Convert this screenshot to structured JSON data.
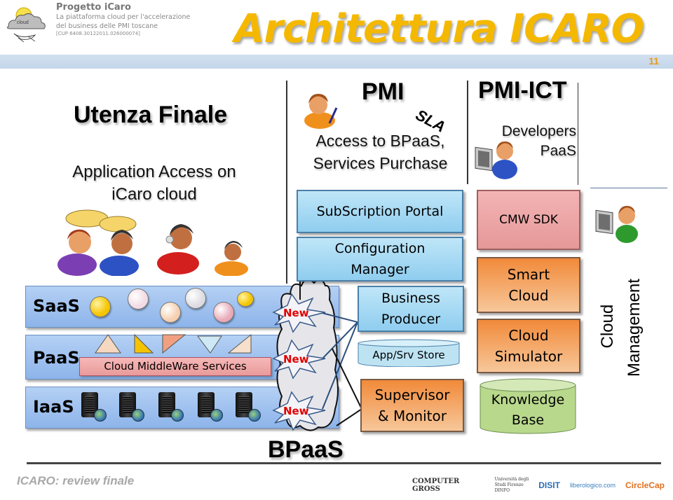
{
  "header": {
    "project_title": "Progetto iCaro",
    "project_subtitle_1": "La piattaforma cloud per l'accelerazione",
    "project_subtitle_2": "del business delle PMI toscane",
    "project_cup": "[CUP 6408.30122011.026000074]",
    "logo_label": "cloud",
    "main_title": "Architettura ICARO",
    "page_number": "11"
  },
  "end_user": {
    "heading": "Utenza Finale",
    "description_1": "Application Access on",
    "description_2": "iCaro cloud"
  },
  "layers": [
    {
      "label": "SaaS",
      "balls": [
        "#f5c400",
        "#f6e4ea",
        "#f7d2b8",
        "#e4e4e8",
        "#eab4c0",
        "#f5c400"
      ]
    },
    {
      "label": "PaaS",
      "middleware": "Cloud MiddleWare Services"
    },
    {
      "label": "IaaS",
      "server_count": 5
    }
  ],
  "bpaas": {
    "label": "BPaaS",
    "new_badges": [
      "New",
      "New",
      "New"
    ]
  },
  "pmi": {
    "heading": "PMI",
    "sla": "SLA",
    "description_1": "Access to BPaaS,",
    "description_2": "Services Purchase",
    "boxes": {
      "subscription_portal": "SubScription Portal",
      "configuration_manager_1": "Configuration",
      "configuration_manager_2": "Manager",
      "business_producer_1": "Business",
      "business_producer_2": "Producer",
      "app_store": "App/Srv Store",
      "supervisor_1": "Supervisor",
      "supervisor_2": "& Monitor"
    }
  },
  "pmi_ict": {
    "heading": "PMI-ICT",
    "description_1": "Developers",
    "description_2": "PaaS",
    "boxes": {
      "cmw_sdk": "CMW SDK",
      "smart_cloud_1": "Smart",
      "smart_cloud_2": "Cloud",
      "cloud_simulator_1": "Cloud",
      "cloud_simulator_2": "Simulator",
      "knowledge_base_1": "Knowledge",
      "knowledge_base_2": "Base"
    }
  },
  "cloud_management": {
    "label_1": "Cloud",
    "label_2": "Management"
  },
  "footer": {
    "text": "ICARO: review  finale",
    "sponsors": [
      "COMPUTER GROSS",
      "Università degli Studi Firenze DINFO",
      "DISIT",
      "liberologico.com",
      "CircleCap"
    ]
  }
}
